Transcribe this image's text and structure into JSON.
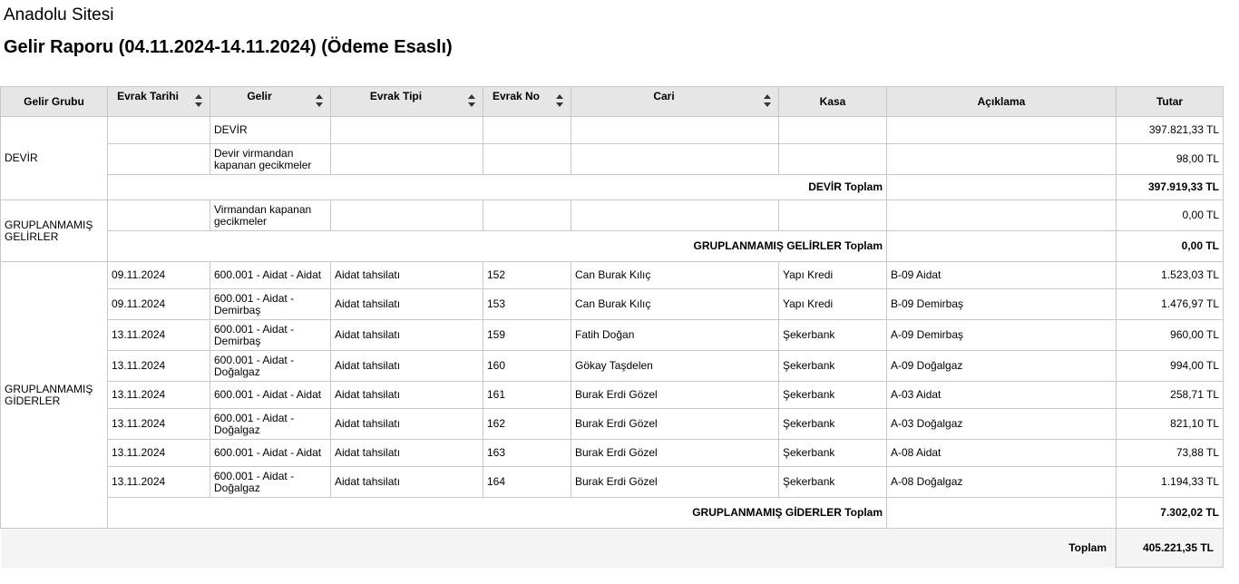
{
  "site_name": "Anadolu Sitesi",
  "report_title": "Gelir Raporu (04.11.2024-14.11.2024) (Ödeme Esaslı)",
  "columns": {
    "gelir_grubu": "Gelir Grubu",
    "evrak_tarihi": "Evrak Tarihi",
    "gelir": "Gelir",
    "evrak_tipi": "Evrak Tipi",
    "evrak_no": "Evrak No",
    "cari": "Cari",
    "kasa": "Kasa",
    "aciklama": "Açıklama",
    "tutar": "Tutar"
  },
  "groups": {
    "devir": {
      "name": "DEVİR",
      "rows": [
        {
          "evrak_tarihi": "",
          "gelir": "DEVİR",
          "evrak_tipi": "",
          "evrak_no": "",
          "cari": "",
          "kasa": "",
          "aciklama": "",
          "tutar": "397.821,33 TL"
        },
        {
          "evrak_tarihi": "",
          "gelir": "Devir virmandan kapanan gecikmeler",
          "evrak_tipi": "",
          "evrak_no": "",
          "cari": "",
          "kasa": "",
          "aciklama": "",
          "tutar": "98,00 TL"
        }
      ],
      "total_label": "DEVİR Toplam",
      "total": "397.919,33 TL"
    },
    "gelirler": {
      "name": "GRUPLANMAMIŞ GELİRLER",
      "rows": [
        {
          "evrak_tarihi": "",
          "gelir": "Virmandan kapanan gecikmeler",
          "evrak_tipi": "",
          "evrak_no": "",
          "cari": "",
          "kasa": "",
          "aciklama": "",
          "tutar": "0,00 TL"
        }
      ],
      "total_label": "GRUPLANMAMIŞ GELİRLER Toplam",
      "total": "0,00 TL"
    },
    "giderler": {
      "name": "GRUPLANMAMIŞ GİDERLER",
      "rows": [
        {
          "evrak_tarihi": "09.11.2024",
          "gelir": "600.001 - Aidat - Aidat",
          "evrak_tipi": "Aidat tahsilatı",
          "evrak_no": "152",
          "cari": "Can Burak Kılıç",
          "kasa": "Yapı Kredi",
          "aciklama": "B-09 Aidat",
          "tutar": "1.523,03 TL"
        },
        {
          "evrak_tarihi": "09.11.2024",
          "gelir": "600.001 - Aidat - Demirbaş",
          "evrak_tipi": "Aidat tahsilatı",
          "evrak_no": "153",
          "cari": "Can Burak Kılıç",
          "kasa": "Yapı Kredi",
          "aciklama": "B-09 Demirbaş",
          "tutar": "1.476,97 TL"
        },
        {
          "evrak_tarihi": "13.11.2024",
          "gelir": "600.001 - Aidat - Demirbaş",
          "evrak_tipi": "Aidat tahsilatı",
          "evrak_no": "159",
          "cari": "Fatih Doğan",
          "kasa": "Şekerbank",
          "aciklama": "A-09 Demirbaş",
          "tutar": "960,00 TL"
        },
        {
          "evrak_tarihi": "13.11.2024",
          "gelir": "600.001 - Aidat - Doğalgaz",
          "evrak_tipi": "Aidat tahsilatı",
          "evrak_no": "160",
          "cari": "Gökay Taşdelen",
          "kasa": "Şekerbank",
          "aciklama": "A-09 Doğalgaz",
          "tutar": "994,00 TL"
        },
        {
          "evrak_tarihi": "13.11.2024",
          "gelir": "600.001 - Aidat - Aidat",
          "evrak_tipi": "Aidat tahsilatı",
          "evrak_no": "161",
          "cari": "Burak Erdi Gözel",
          "kasa": "Şekerbank",
          "aciklama": "A-03 Aidat",
          "tutar": "258,71 TL"
        },
        {
          "evrak_tarihi": "13.11.2024",
          "gelir": "600.001 - Aidat - Doğalgaz",
          "evrak_tipi": "Aidat tahsilatı",
          "evrak_no": "162",
          "cari": "Burak Erdi Gözel",
          "kasa": "Şekerbank",
          "aciklama": "A-03 Doğalgaz",
          "tutar": "821,10 TL"
        },
        {
          "evrak_tarihi": "13.11.2024",
          "gelir": "600.001 - Aidat - Aidat",
          "evrak_tipi": "Aidat tahsilatı",
          "evrak_no": "163",
          "cari": "Burak Erdi Gözel",
          "kasa": "Şekerbank",
          "aciklama": "A-08 Aidat",
          "tutar": "73,88 TL"
        },
        {
          "evrak_tarihi": "13.11.2024",
          "gelir": "600.001 - Aidat - Doğalgaz",
          "evrak_tipi": "Aidat tahsilatı",
          "evrak_no": "164",
          "cari": "Burak Erdi Gözel",
          "kasa": "Şekerbank",
          "aciklama": "A-08 Doğalgaz",
          "tutar": "1.194,33 TL"
        }
      ],
      "total_label": "GRUPLANMAMIŞ GİDERLER Toplam",
      "total": "7.302,02 TL"
    }
  },
  "grand_total_label": "Toplam",
  "grand_total": "405.221,35 TL"
}
